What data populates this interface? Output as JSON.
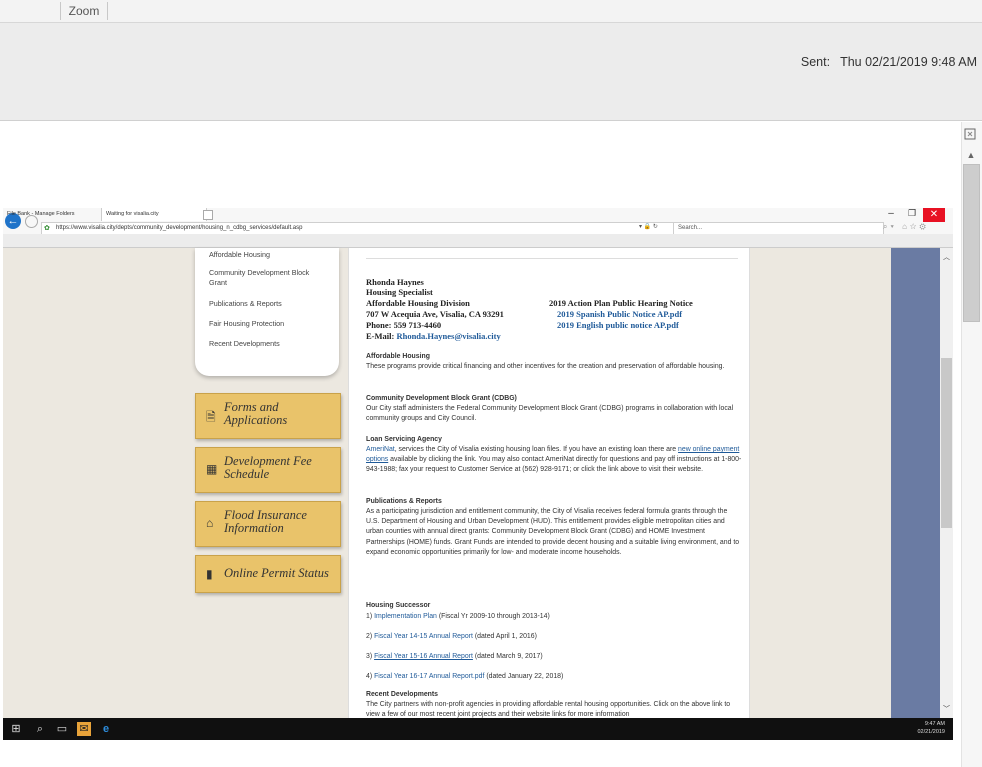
{
  "outlook": {
    "zoom_label": "Zoom",
    "sent_label": "Sent:",
    "sent_value": "Thu 02/21/2019 9:48 AM"
  },
  "browser": {
    "url": "https://www.visalia.city/depts/community_development/housing_n_cdbg_services/default.asp",
    "address_controls": "▾ 🔒 ↻",
    "search_placeholder": "Search...",
    "tabs": [
      "File Bank - Manage Folders",
      "Waiting for visalia.city"
    ]
  },
  "site": {
    "menu_items": [
      "Affordable Housing",
      "Community Development Block Grant",
      "Publications & Reports",
      "Fair Housing Protection",
      "Recent Developments"
    ],
    "side_buttons": [
      {
        "label": "Forms and Applications",
        "icon": "document-icon"
      },
      {
        "label": "Development Fee Schedule",
        "icon": "calendar-icon"
      },
      {
        "label": "Flood Insurance Information",
        "icon": "house-flood-icon"
      },
      {
        "label": "Online Permit Status",
        "icon": "file-icon"
      }
    ],
    "contact": {
      "name": "Rhonda Haynes",
      "title": "Housing Specialist",
      "division": "Affordable Housing Division",
      "address": "707 W Acequia Ave, Visalia, CA 93291",
      "phone": "Phone:  559 713-4460",
      "email_label": "E-Mail:",
      "email": "Rhonda.Haynes@visalia.city"
    },
    "notice": {
      "title": "2019 Action Plan Public Hearing Notice",
      "spanish": "2019 Spanish Public Notice AP.pdf",
      "english": "2019 English public notice AP.pdf"
    },
    "sections": {
      "affordable_head": "Affordable Housing",
      "affordable_body": "These programs provide critical financing and other incentives for the creation and preservation of affordable housing.",
      "cdbg_head": "Community Development Block Grant (CDBG)",
      "cdbg_body": "Our City staff administers the Federal Community Development Block Grant (CDBG) programs in collaboration with local community groups and City Council.",
      "loan_head": "Loan Servicing Agency",
      "loan_link1": "AmeriNat",
      "loan_body1": ", services the City of Visalia existing housing loan files.  If you have an existing loan there are",
      "loan_link2": "new online payment options",
      "loan_body2": " available by clicking the link.  You may also contact AmeriNat directly for questions and pay off instructions at 1-800-943-1988; fax your request to Customer Service at (562) 928-9171; or click the link above to visit their website.",
      "pub_head": "Publications & Reports",
      "pub_body": "As a participating jurisdiction and entitlement community, the City of Visalia receives federal formula grants through the U.S. Department of Housing and Urban Development (HUD).  This entitlement provides eligible metropolitan cities and urban counties with annual direct grants:  Community Development Block Grant (CDBG) and HOME Investment Partnerships (HOME) funds.  Grant Funds are intended to provide decent housing and a suitable living environment, and to expand economic opportunities primarily for low- and moderate income households.",
      "successor_head": "Housing Successor",
      "s1_num": "1)",
      "s1_link": "Implementation Plan",
      "s1_text": "(Fiscal Yr 2009-10 through 2013-14)",
      "s2_num": "2)",
      "s2_link": "Fiscal Year 14-15 Annual Report",
      "s2_text": "(dated April 1, 2016)",
      "s3_num": "3)",
      "s3_link": "Fiscal Year 15-16 Annual Report",
      "s3_text": "(dated March 9, 2017)",
      "s4_num": "4)",
      "s4_link": "Fiscal Year 16-17 Annual Report.pdf",
      "s4_text": "(dated January 22, 2018)",
      "recent_head": "Recent Developments",
      "recent_body": "The City partners with non-profit agencies in providing affordable rental housing opportunities.  Click on the above link to view a few of our most recent joint projects and their website links for more information"
    }
  },
  "taskbar": {
    "time": "9:47 AM",
    "date": "02/21/2019"
  }
}
